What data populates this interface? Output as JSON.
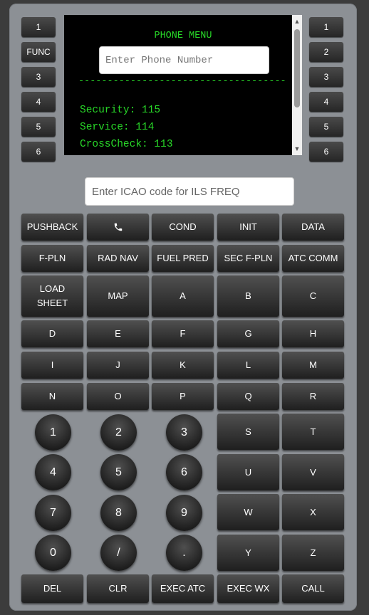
{
  "left_lsk": [
    "1",
    "FUNC",
    "3",
    "4",
    "5",
    "6"
  ],
  "right_lsk": [
    "1",
    "2",
    "3",
    "4",
    "5",
    "6"
  ],
  "screen": {
    "title": "PHONE MENU",
    "phone_placeholder": "Enter Phone Number",
    "divider": "-----------------------------------------------",
    "entries": [
      "Security: 115",
      "Service: 114",
      "CrossCheck: 113"
    ]
  },
  "icao_placeholder": "Enter ICAO code for ILS FREQ",
  "keys": {
    "pushback": "PUSHBACK",
    "phone_icon": "phone-icon",
    "cond": "COND",
    "init": "INIT",
    "data": "DATA",
    "fpln": "F-PLN",
    "rad_nav": "RAD NAV",
    "fuel_pred": "FUEL PRED",
    "sec_fpln": "SEC F-PLN",
    "atc_comm": "ATC COMM",
    "load_sheet_1": "LOAD",
    "load_sheet_2": "SHEET",
    "map": "MAP",
    "letters": [
      "A",
      "B",
      "C",
      "D",
      "E",
      "F",
      "G",
      "H",
      "I",
      "J",
      "K",
      "L",
      "M",
      "N",
      "O",
      "P",
      "Q",
      "R",
      "S",
      "T",
      "U",
      "V",
      "W",
      "X",
      "Y",
      "Z"
    ],
    "digits": [
      "1",
      "2",
      "3",
      "4",
      "5",
      "6",
      "7",
      "8",
      "9",
      "0",
      "/",
      "."
    ],
    "del": "DEL",
    "clr": "CLR",
    "exec_atc": "EXEC ATC",
    "exec_wx": "EXEC WX",
    "call": "CALL"
  },
  "colors": {
    "screen_text": "#28d828",
    "panel": "#8c9095"
  }
}
